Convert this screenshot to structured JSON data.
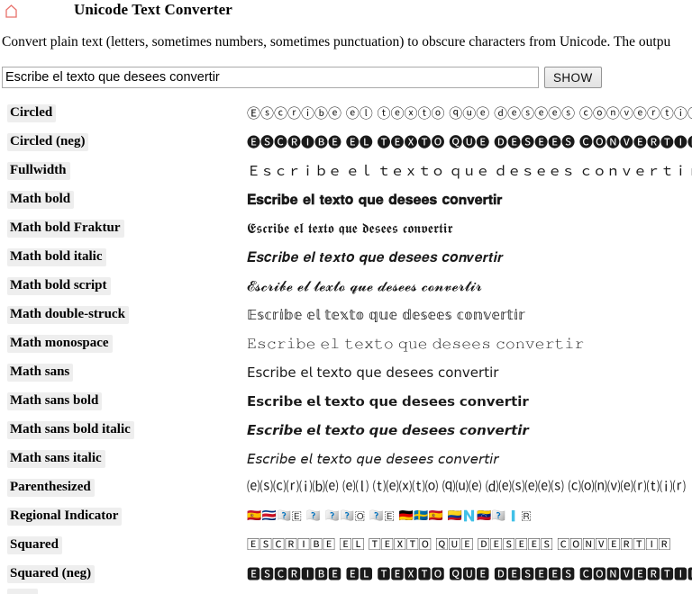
{
  "header": {
    "home_icon": "home-icon",
    "title": "Unicode Text Converter"
  },
  "intro": {
    "text": "Convert plain text (letters, sometimes numbers, sometimes punctuation) to obscure characters from Unicode. The outpu"
  },
  "form": {
    "input_value": "Escribe el texto que desees convertir",
    "input_placeholder": "Escribe el texto que desees convertir",
    "submit_label": "SHOW"
  },
  "results": {
    "rows": [
      {
        "label": "Circled",
        "value": "Ⓔⓢⓒⓡⓘⓑⓔ ⓔⓛ ⓣⓔⓧⓣⓞ ⓠⓤⓔ ⓓⓔⓢⓔⓔⓢ ⓒⓞⓝⓥⓔⓡⓣⓘⓡ"
      },
      {
        "label": "Circled (neg)",
        "value": "🅔🅢🅒🅡🅘🅑🅔 🅔🅛 🅣🅔🅧🅣🅞 🅠🅤🅔 🅓🅔🅢🅔🅔🅢 🅒🅞🅝🅥🅔🅡🅣🅘🅡"
      },
      {
        "label": "Fullwidth",
        "value": "Ｅｓｃｒｉｂｅ ｅｌ ｔｅｘｔｏ ｑｕｅ ｄｅｓｅｅｓ ｃｏｎｖｅｒｔｉｒ"
      },
      {
        "label": "Math bold",
        "value": "𝐄𝐬𝐜𝐫𝐢𝐛𝐞 𝐞𝐥 𝐭𝐞𝐱𝐭𝐨 𝐪𝐮𝐞 𝐝𝐞𝐬𝐞𝐞𝐬 𝐜𝐨𝐧𝐯𝐞𝐫𝐭𝐢𝐫"
      },
      {
        "label": "Math bold Fraktur",
        "value": "𝕰𝖘𝖈𝖗𝖎𝖇𝖊 𝖊𝖑 𝖙𝖊𝖝𝖙𝖔 𝖖𝖚𝖊 𝖉𝖊𝖘𝖊𝖊𝖘 𝖈𝖔𝖓𝖛𝖊𝖗𝖙𝖎𝖗"
      },
      {
        "label": "Math bold italic",
        "value": "𝑬𝒔𝒄𝒓𝒊𝒃𝒆 𝒆𝒍 𝒕𝒆𝒙𝒕𝒐 𝒒𝒖𝒆 𝒅𝒆𝒔𝒆𝒆𝒔 𝒄𝒐𝒏𝒗𝒆𝒓𝒕𝒊𝒓"
      },
      {
        "label": "Math bold script",
        "value": "𝓔𝓼𝓬𝓻𝓲𝓫𝓮 𝓮𝓵 𝓽𝓮𝔁𝓽𝓸 𝓺𝓾𝓮 𝓭𝓮𝓼𝓮𝓮𝓼 𝓬𝓸𝓷𝓿𝓮𝓻𝓽𝓲𝓻"
      },
      {
        "label": "Math double-struck",
        "value": "𝔼𝕤𝕔𝕣𝕚𝕓𝕖 𝕖𝕝 𝕥𝕖𝕩𝕥𝕠 𝕢𝕦𝕖 𝕕𝕖𝕤𝕖𝕖𝕤 𝕔𝕠𝕟𝕧𝕖𝕣𝕥𝕚𝕣"
      },
      {
        "label": "Math monospace",
        "value": "𝙴𝚜𝚌𝚛𝚒𝚋𝚎 𝚎𝚕 𝚝𝚎𝚡𝚝𝚘 𝚚𝚞𝚎 𝚍𝚎𝚜𝚎𝚎𝚜 𝚌𝚘𝚗𝚟𝚎𝚛𝚝𝚒𝚛"
      },
      {
        "label": "Math sans",
        "value": "𝖤𝗌𝖼𝗋𝗂𝖻𝖾 𝖾𝗅 𝗍𝖾𝗑𝗍𝗈 𝗊𝗎𝖾 𝖽𝖾𝗌𝖾𝖾𝗌 𝖼𝗈𝗇𝗏𝖾𝗋𝗍𝗂𝗋"
      },
      {
        "label": "Math sans bold",
        "value": "𝗘𝘀𝗰𝗿𝗶𝗯𝗲 𝗲𝗹 𝘁𝗲𝘅𝘁𝗼 𝗾𝘂𝗲 𝗱𝗲𝘀𝗲𝗲𝘀 𝗰𝗼𝗻𝘃𝗲𝗿𝘁𝗶𝗿"
      },
      {
        "label": "Math sans bold italic",
        "value": "𝙀𝙨𝙘𝙧𝙞𝙗𝙚 𝙚𝙡 𝙩𝙚𝙭𝙩𝙤 𝙦𝙪𝙚 𝙙𝙚𝙨𝙚𝙚𝙨 𝙘𝙤𝙣𝙫𝙚𝙧𝙩𝙞𝙧"
      },
      {
        "label": "Math sans italic",
        "value": "𝘌𝘴𝘤𝘳𝘪𝘣𝘦 𝘦𝘭 𝘵𝘦𝘹𝘵𝘰 𝘲𝘶𝘦 𝘥𝘦𝘴𝘦𝘦𝘴 𝘤𝘰𝘯𝘷𝘦𝘳𝘵𝘪𝘳"
      },
      {
        "label": "Parenthesized",
        "value": "⒠⒮⒞⒭⒤⒝⒠ ⒠⒧ ⒯⒠⒳⒯⒪ ⒬⒰⒠ ⒟⒠⒮⒠⒠⒮ ⒞⒪⒩⒱⒠⒭⒯⒤⒭"
      },
      {
        "label": "Regional Indicator",
        "value": "🇪🇸🇨🇷🇮🇧🇪 🇪🇱 🇹🇪🇽🇹🇴 🇶🇺🇪 🇩🇪🇸🇪🇪🇸 🇨🇴🇳🇻🇪🇷🇹🇮🇷"
      },
      {
        "label": "Squared",
        "value": "🄴🅂🄲🅁🄸🄱🄴 🄴🄻 🅃🄴🅇🅃🄾 🅀🅄🄴 🄳🄴🅂🄴🄴🅂 🄲🄾🄽🅅🄴🅁🅃🄸🅁"
      },
      {
        "label": "Squared (neg)",
        "value": "🅴🆂🅲🆁🅸🅱🅴 🅴🅻 🆃🅴🆇🆃🅾 🆀🆄🅴 🅳🅴🆂🅴🅴🆂 🅲🅾🅽🆅🅴🆁🆃🅸🆁"
      }
    ]
  },
  "colors": {
    "home_icon": "#e8706a",
    "label_highlight": "#eeeeee",
    "input_border": "#a9a9a9",
    "button_border": "#949494",
    "page_background": "#ffffff",
    "text": "#000000"
  }
}
